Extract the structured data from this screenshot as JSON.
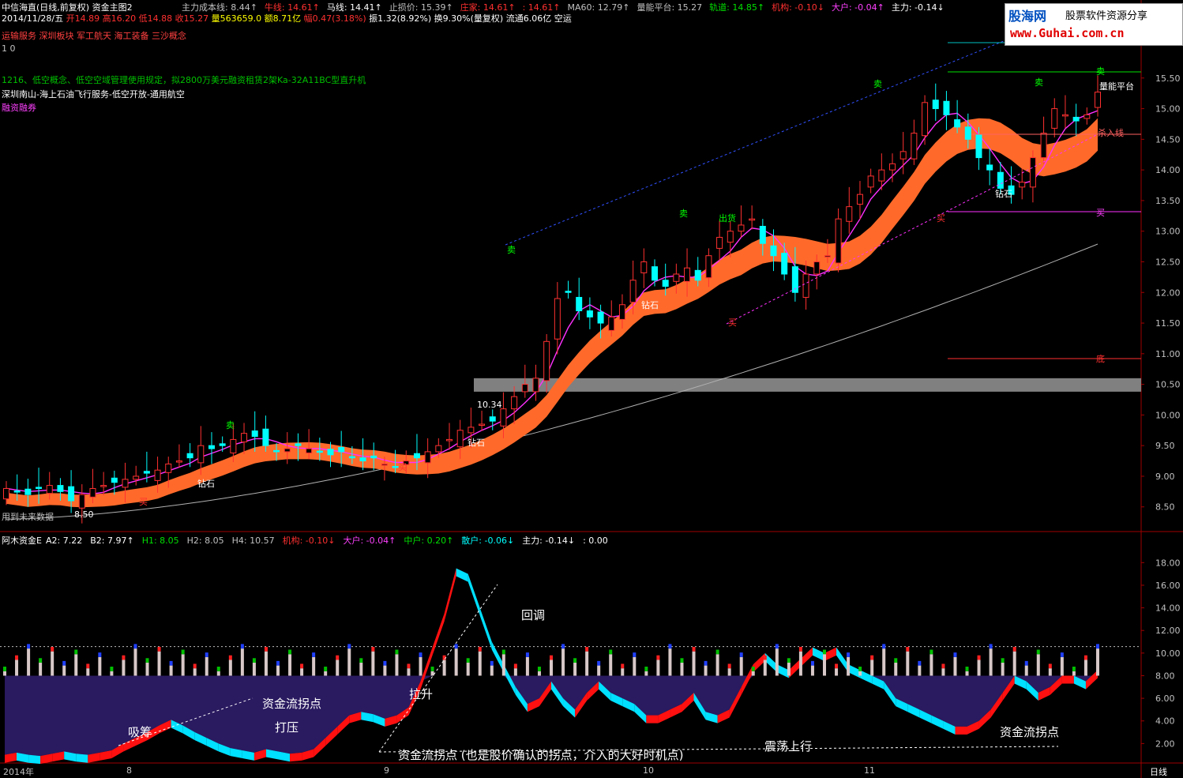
{
  "header": {
    "title": "中信海直(日线,前复权) 资金主图2",
    "indicators_row1": [
      {
        "label": "主力成本线:",
        "value": "8.44",
        "arrow": "↑",
        "color": "#c0c0c0"
      },
      {
        "label": "牛线:",
        "value": "14.61",
        "arrow": "↑",
        "color": "#ff3030"
      },
      {
        "label": "马线:",
        "value": "14.41",
        "arrow": "↑",
        "color": "#ffffff"
      },
      {
        "label": "止损价:",
        "value": "15.39",
        "arrow": "↑",
        "color": "#c0c0c0"
      },
      {
        "label": "庄家:",
        "value": "14.61",
        "arrow": "↑",
        "color": "#ff3030"
      },
      {
        "label": ":",
        "value": "14.61",
        "arrow": "↑",
        "color": "#ff3030"
      },
      {
        "label": "MA60:",
        "value": "12.79",
        "arrow": "↑",
        "color": "#c0c0c0"
      },
      {
        "label": "量能平台:",
        "value": "15.27",
        "arrow": "",
        "color": "#c0c0c0"
      },
      {
        "label": "轨道:",
        "value": "14.85",
        "arrow": "↑",
        "color": "#00e000"
      },
      {
        "label": "机构:",
        "value": "-0.10",
        "arrow": "↓",
        "color": "#ff3030"
      },
      {
        "label": "大户:",
        "value": "-0.04",
        "arrow": "↑",
        "color": "#ff40ff"
      },
      {
        "label": "主力:",
        "value": "-0.14",
        "arrow": "↓",
        "color": "#ffffff"
      }
    ],
    "date_row": {
      "date": "2014/11/28/五",
      "open_label": "开",
      "open": "14.89",
      "high_label": "高",
      "high": "16.20",
      "low_label": "低",
      "low": "14.88",
      "close_label": "收",
      "close": "15.27",
      "vol_label": "量",
      "vol": "563659.0",
      "amt_label": "额",
      "amt": "8.71亿",
      "chg_label": "幅",
      "chg": "0.47(3.18%)",
      "amp_label": "振",
      "amp": "1.32(8.92%)",
      "turn_label": "换",
      "turn": "9.30%(量复权)",
      "float_label": "流通",
      "float": "6.06亿",
      "tag": "空运"
    },
    "concepts": [
      "运输服务",
      "深圳板块",
      "军工航天",
      "海工装备",
      "三沙概念"
    ],
    "line_10": "1 0",
    "news1": "1216、低空概念、低空空域管理使用规定，拟2800万美元融资租赁2架Ka-32A11BC型直升机",
    "news2": "深圳南山-海上石油飞行服务-低空开放-通用航空",
    "news3": "融资融券"
  },
  "logo": {
    "name": "股海网",
    "slogan": "股票软件资源分享",
    "url": "www.Guhai.com.cn"
  },
  "main_annotations": {
    "future_data": "用到未来数据",
    "low_price": "8.50",
    "mid_price": "10.34",
    "sell": "卖",
    "buy": "买",
    "diamond": "钻石",
    "ship": "出货",
    "volume_platform": "量能平台",
    "kill_line": "杀入线",
    "bottom": "底"
  },
  "sub_header": {
    "name": "阿木资金E",
    "items": [
      {
        "label": "A2:",
        "value": "7.22",
        "color": "#ffffff"
      },
      {
        "label": "B2:",
        "value": "7.97",
        "color": "#ffffff",
        "arrow": "↑"
      },
      {
        "label": "H1:",
        "value": "8.05",
        "color": "#00e000"
      },
      {
        "label": "H2:",
        "value": "8.05",
        "color": "#c0c0c0"
      },
      {
        "label": "H4:",
        "value": "10.57",
        "color": "#c0c0c0"
      },
      {
        "label": "机构:",
        "value": "-0.10",
        "color": "#ff3030",
        "arrow": "↓"
      },
      {
        "label": "大户:",
        "value": "-0.04",
        "color": "#ff40ff",
        "arrow": "↑"
      },
      {
        "label": "中户:",
        "value": "0.20",
        "color": "#00e000",
        "arrow": "↑"
      },
      {
        "label": "散户:",
        "value": "-0.06",
        "color": "#00ffff",
        "arrow": "↓"
      },
      {
        "label": "主力:",
        "value": "-0.14",
        "color": "#ffffff",
        "arrow": "↓"
      },
      {
        "label": ":",
        "value": "0.00",
        "color": "#ffffff"
      }
    ]
  },
  "sub_annotations": {
    "absorb": "吸筹",
    "turn1": "资金流拐点",
    "suppress": "打压",
    "pullup": "拉升",
    "pullback": "回调",
    "turn_long": "资金流拐点 (也是股价确认的拐点，介入的大好时机点)",
    "oscillate": "震荡上行",
    "turn2": "资金流拐点"
  },
  "footer": {
    "year": "2014年",
    "m8": "8",
    "m9": "9",
    "m10": "10",
    "m11": "11",
    "period": "日线"
  },
  "colors": {
    "up": "#ff3030",
    "down": "#00ffff",
    "band": "#ff6a2a",
    "purple": "#2a1a60",
    "cyan": "#00e0ff",
    "grid": "#800000"
  },
  "chart_data": [
    {
      "type": "candlestick",
      "title": "中信海直(日线,前复权)",
      "y_ticks": [
        8.5,
        9.0,
        9.5,
        10.0,
        10.5,
        11.0,
        11.5,
        12.0,
        12.5,
        13.0,
        13.5,
        14.0,
        14.5,
        15.0,
        15.5
      ],
      "ylim": [
        8.2,
        16.0
      ],
      "closes": [
        8.8,
        8.75,
        8.7,
        8.8,
        8.85,
        8.75,
        8.6,
        8.7,
        8.8,
        8.85,
        8.9,
        8.95,
        9.0,
        9.05,
        9.1,
        9.2,
        9.25,
        9.3,
        9.5,
        9.45,
        9.5,
        9.6,
        9.7,
        9.65,
        9.5,
        9.4,
        9.45,
        9.5,
        9.45,
        9.4,
        9.35,
        9.4,
        9.3,
        9.25,
        9.3,
        9.2,
        9.15,
        9.25,
        9.3,
        9.4,
        9.5,
        9.6,
        9.75,
        9.8,
        9.85,
        9.9,
        10.1,
        10.3,
        10.5,
        10.6,
        11.2,
        11.9,
        12.0,
        11.7,
        11.6,
        11.5,
        11.6,
        11.8,
        12.2,
        12.5,
        12.2,
        12.1,
        12.3,
        12.4,
        12.2,
        12.6,
        12.9,
        13.0,
        13.1,
        13.2,
        12.8,
        12.6,
        12.3,
        12.0,
        12.3,
        12.5,
        12.6,
        13.2,
        13.4,
        13.6,
        13.9,
        14.0,
        14.1,
        14.3,
        14.6,
        15.1,
        15.0,
        14.9,
        14.7,
        14.5,
        14.2,
        14.0,
        13.7,
        13.6,
        13.8,
        14.2,
        14.6,
        15.0,
        14.9,
        14.8,
        14.9,
        15.27
      ],
      "ma60_start": 8.3,
      "ma60_end": 12.79
    },
    {
      "type": "bar",
      "title": "阿木资金E",
      "y_ticks": [
        2.0,
        4.0,
        6.0,
        8.0,
        10.0,
        12.0,
        14.0,
        16.0,
        18.0
      ],
      "ylim": [
        0,
        19
      ],
      "flow": [
        1.0,
        1.2,
        1.0,
        0.9,
        1.1,
        1.3,
        1.1,
        1.0,
        1.2,
        1.4,
        2.0,
        2.5,
        3.0,
        3.6,
        4.1,
        3.6,
        3.0,
        2.5,
        2.0,
        1.6,
        1.4,
        1.2,
        1.5,
        1.3,
        1.1,
        1.2,
        1.5,
        2.5,
        3.5,
        4.5,
        4.8,
        4.6,
        4.2,
        4.5,
        5.2,
        7.5,
        10.5,
        13.5,
        17.5,
        17.0,
        14.0,
        11.0,
        9.0,
        7.0,
        5.5,
        6.0,
        7.5,
        6.0,
        5.0,
        6.5,
        7.5,
        6.5,
        6.0,
        5.5,
        4.5,
        4.5,
        5.0,
        5.5,
        6.5,
        4.8,
        4.5,
        5.0,
        7.0,
        9.0,
        10.0,
        9.0,
        8.5,
        9.5,
        10.5,
        10.0,
        10.5,
        9.0,
        8.5,
        8.0,
        7.5,
        6.0,
        5.5,
        5.0,
        4.5,
        4.0,
        3.5,
        3.5,
        4.0,
        5.0,
        6.5,
        8.0,
        7.5,
        6.5,
        7.0,
        8.0,
        8.0,
        7.5,
        8.5
      ]
    }
  ]
}
